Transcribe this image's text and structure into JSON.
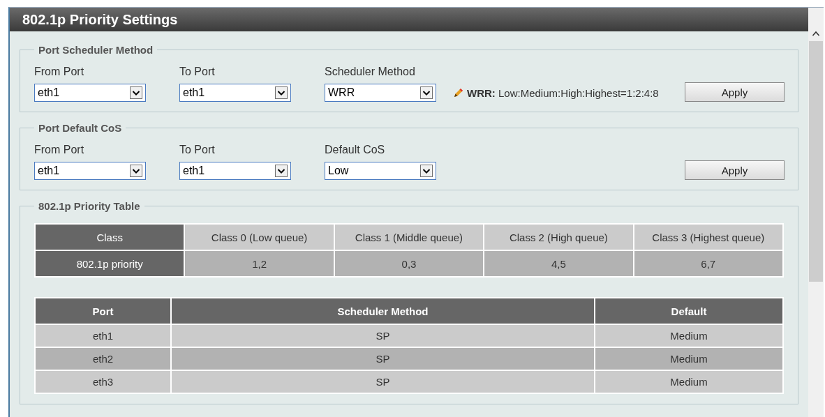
{
  "title": "802.1p Priority Settings",
  "sections": [
    {
      "legend": "Port Scheduler Method",
      "fields": [
        {
          "label": "From Port",
          "value": "eth1"
        },
        {
          "label": "To Port",
          "value": "eth1"
        },
        {
          "label": "Scheduler Method",
          "value": "WRR"
        }
      ],
      "note": "**WRR:** Low:Medium:High:Highest=1:2:4:8",
      "apply": "Apply"
    },
    {
      "legend": "Port Default CoS",
      "fields": [
        {
          "label": "From Port",
          "value": "eth1"
        },
        {
          "label": "To Port",
          "value": "eth1"
        },
        {
          "label": "Default CoS",
          "value": "Low"
        }
      ],
      "apply": "Apply"
    }
  ],
  "priority_table": {
    "legend": "802.1p Priority Table",
    "rows": [
      {
        "label": "Class",
        "cells": [
          "Class 0 (Low queue)",
          "Class 1 (Middle queue)",
          "Class 2 (High queue)",
          "Class 3 (Highest queue)"
        ]
      },
      {
        "label": "802.1p priority",
        "cells": [
          "1,2",
          "0,3",
          "4,5",
          "6,7"
        ]
      }
    ]
  },
  "port_table": {
    "columns": [
      "Port",
      "Scheduler Method",
      "Default"
    ],
    "rows": [
      [
        "eth1",
        "SP",
        "Medium"
      ],
      [
        "eth2",
        "SP",
        "Medium"
      ],
      [
        "eth3",
        "SP",
        "Medium"
      ]
    ]
  }
}
